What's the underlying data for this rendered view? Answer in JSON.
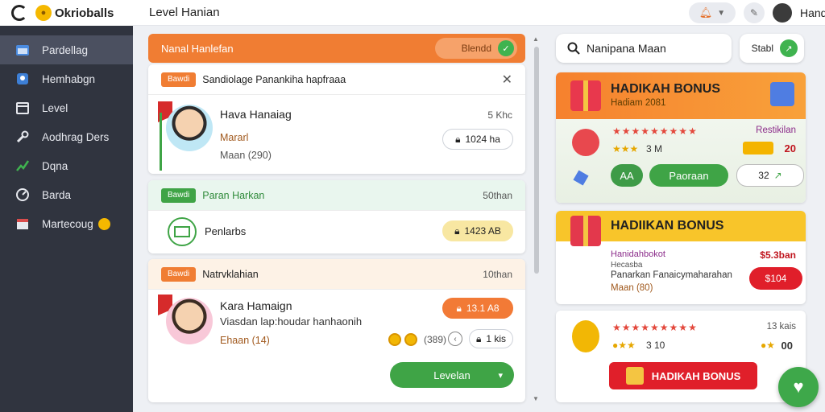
{
  "brand": {
    "name": "Okrioballs"
  },
  "sidebar": {
    "items": [
      {
        "label": "Pardellag",
        "icon": "calendar-icon"
      },
      {
        "label": "Hemhabgn",
        "icon": "user-badge-icon"
      },
      {
        "label": "Level",
        "icon": "calendar-grid-icon"
      },
      {
        "label": "Aodhrag Ders",
        "icon": "wrench-icon"
      },
      {
        "label": "Dqna",
        "icon": "chart-icon"
      },
      {
        "label": "Barda",
        "icon": "gauge-icon"
      },
      {
        "label": "Martecoug",
        "icon": "store-icon"
      }
    ]
  },
  "header": {
    "title": "Level Hanian",
    "username": "Handan"
  },
  "mid": {
    "banner": {
      "title": "Nanal Hanlefan",
      "pill": "Blendd"
    },
    "card1": {
      "tag": "Bawdi",
      "title": "Sandiolage Panankiha hapfraaa",
      "name": "Hava Hanaiag",
      "time": "5 Khc",
      "line1": "Mararl",
      "line2": "Maan (290)",
      "chip": "1024 ha"
    },
    "card2": {
      "tag": "Bawdi",
      "title": "Paran Harkan",
      "right": "50than",
      "item": "Penlarbs",
      "chip": "1423 AB"
    },
    "card3": {
      "tag": "Bawdi",
      "title": "Natrvklahian",
      "right": "10than",
      "name": "Kara Hamaign",
      "desc": "Viasdan lap:houdar hanhaonih",
      "line": "Ehaan (14)",
      "chip_orange": "13.1 A8",
      "chip_count": "(389)",
      "chip_small": "1 kis",
      "button": "Levelan"
    }
  },
  "right": {
    "search_text": "Nanipana Maan",
    "stat_label": "Stabl",
    "bonus1": {
      "title": "HADIKAH BONUS",
      "sub": "Hadiam 2081",
      "link": "Restikilan",
      "rate": "3 M",
      "count": "20",
      "btn_left": "AA",
      "btn_mid": "Paoraan",
      "btn_right": "32"
    },
    "bonus2": {
      "title": "HADIIKAN BONUS",
      "line1": "Hanidahbokot",
      "line2": "Hecasba",
      "line3": "Panarkan Fanaicymaharahan",
      "line4": "Maan (80)",
      "price": "$5.3ban",
      "btn": "$104"
    },
    "bonus3": {
      "count": "13 kais",
      "rate": "3 10",
      "count2": "00",
      "btn": "HADIKAH BONUS"
    }
  },
  "colors": {
    "orange": "#f07d33",
    "green": "#3fa446",
    "red": "#e01f2a",
    "sidebar": "#30343f"
  }
}
